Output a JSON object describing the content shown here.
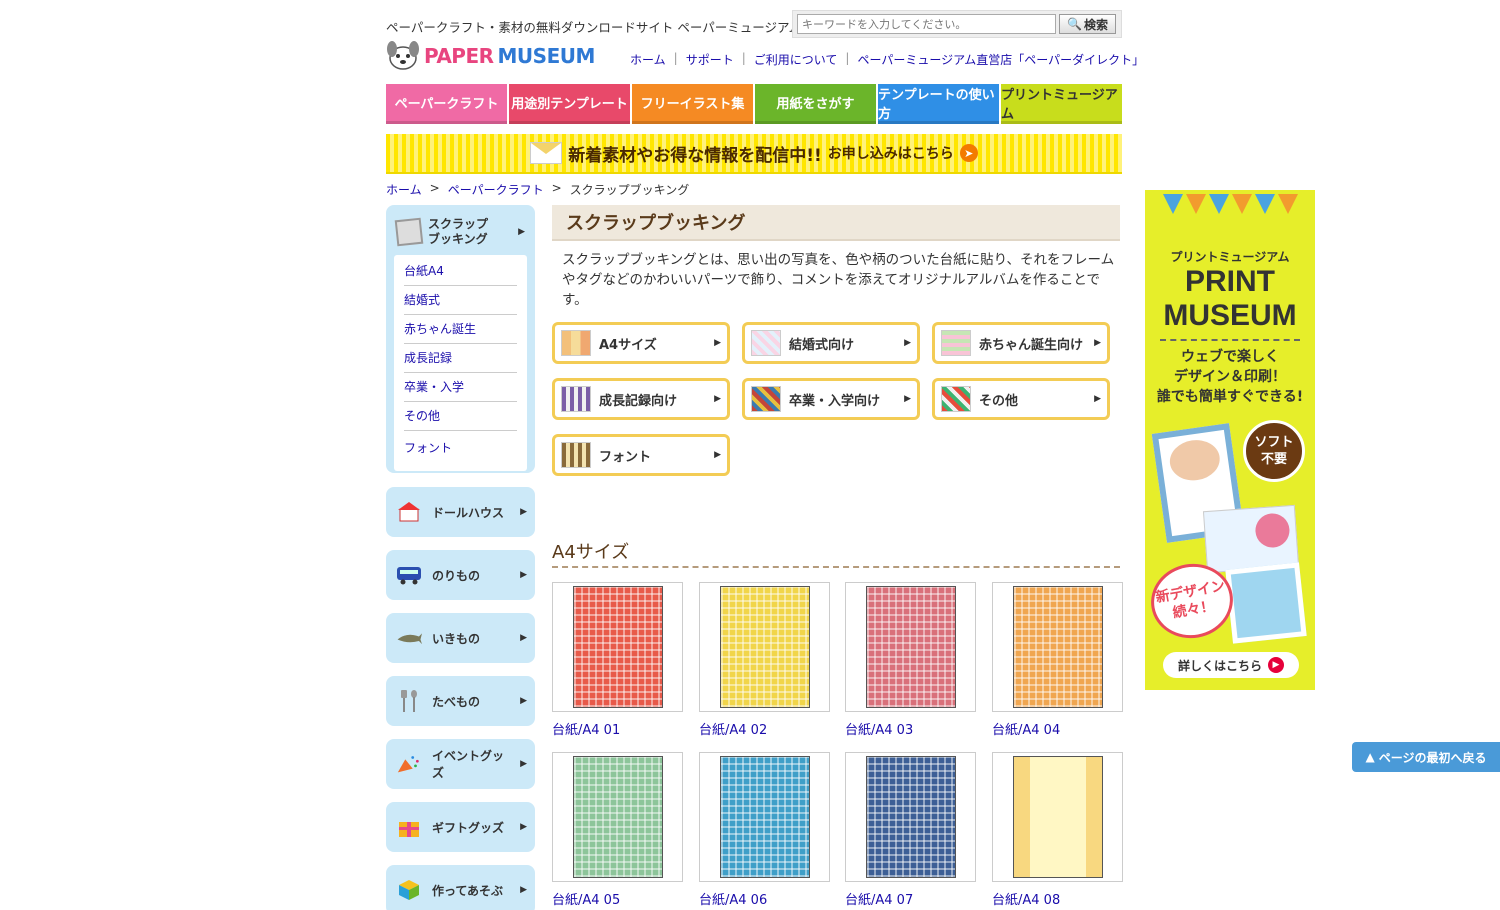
{
  "header": {
    "tagline": "ペーパークラフト・素材の無料ダウンロードサイト ペーパーミュージアム",
    "search_placeholder": "キーワードを入力してください。",
    "search_button": "検索",
    "logo_part1": "PAPER",
    "logo_part2": "MUSEUM",
    "links": [
      "ホーム",
      "サポート",
      "ご利用について",
      "ペーパーミュージアム直営店「ペーパーダイレクト」"
    ]
  },
  "gnav": [
    {
      "label": "ペーパークラフト",
      "color": "#f06aa5"
    },
    {
      "label": "用途別テンプレート",
      "color": "#e8496a"
    },
    {
      "label": "フリーイラスト集",
      "color": "#f58a23"
    },
    {
      "label": "用紙をさがす",
      "color": "#6bb52a"
    },
    {
      "label": "テンプレートの使い方",
      "color": "#2f8fe6"
    },
    {
      "label": "プリントミュージアム",
      "color": "#c8dd1c"
    }
  ],
  "banner": {
    "main": "新着素材やお得な情報を配信中!!",
    "cta": "お申し込みはこちら"
  },
  "breadcrumb": [
    "ホーム",
    ">",
    "ペーパークラフト",
    ">",
    "スクラップブッキング"
  ],
  "sidebar": {
    "current": {
      "label_line1": "スクラップ",
      "label_line2": "ブッキング"
    },
    "sub_items": [
      "台紙A4",
      "結婚式",
      "赤ちゃん誕生",
      "成長記録",
      "卒業・入学",
      "その他",
      "フォント"
    ],
    "categories": [
      {
        "label": "ドールハウス",
        "icon": "house-icon"
      },
      {
        "label": "のりもの",
        "icon": "bus-icon"
      },
      {
        "label": "いきもの",
        "icon": "shark-icon"
      },
      {
        "label": "たべもの",
        "icon": "fork-spoon-icon"
      },
      {
        "label": "イベントグッズ",
        "icon": "party-popper-icon"
      },
      {
        "label": "ギフトグッズ",
        "icon": "gift-icon"
      },
      {
        "label": "作ってあそぶ",
        "icon": "cube-icon"
      }
    ]
  },
  "main": {
    "title": "スクラップブッキング",
    "intro": "スクラップブッキングとは、思い出の写真を、色や柄のついた台紙に貼り、それをフレームやタグなどのかわいいパーツで飾り、コメントを添えてオリジナルアルバムを作ることです。",
    "categories": [
      "A4サイズ",
      "結婚式向け",
      "赤ちゃん誕生向け",
      "成長記録向け",
      "卒業・入学向け",
      "その他",
      "フォント"
    ],
    "section_title": "A4サイズ",
    "items": [
      {
        "caption": "台紙/A4 01",
        "color": "#e85a4a"
      },
      {
        "caption": "台紙/A4 02",
        "color": "#f1d54a"
      },
      {
        "caption": "台紙/A4 03",
        "color": "#d9707a"
      },
      {
        "caption": "台紙/A4 04",
        "color": "#f0a650"
      },
      {
        "caption": "台紙/A4 05",
        "color": "#8dc59a"
      },
      {
        "caption": "台紙/A4 06",
        "color": "#3f9fc8"
      },
      {
        "caption": "台紙/A4 07",
        "color": "#3d5f96"
      },
      {
        "caption": "台紙/A4 08",
        "color": "#f8d880"
      }
    ]
  },
  "ad": {
    "small": "プリントミュージアム",
    "big1": "PRINT",
    "big2": "MUSEUM",
    "copy1": "ウェブで楽しく",
    "copy2": "デザイン＆印刷！",
    "copy3": "誰でも簡単すぐできる!",
    "soft1": "ソフト",
    "soft2": "不要",
    "new1": "新デザイン",
    "new2": "続々！",
    "more": "詳しくはこちら"
  },
  "to_top": "ページの最初へ戻る"
}
